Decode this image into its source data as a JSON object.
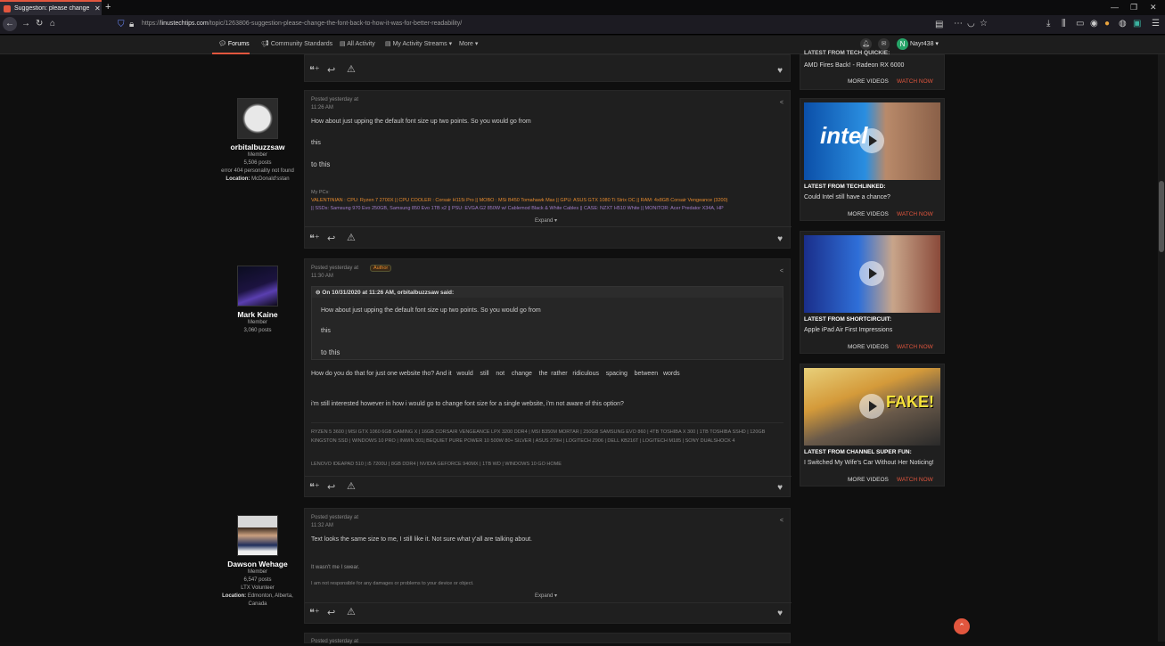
{
  "browser": {
    "tab_title": "Suggestion: please change the",
    "url_prefix": "https://",
    "url_domain": "linustechtips.com",
    "url_path": "/topic/1263806-suggestion-please-change-the-font-back-to-how-it-was-for-better-readability/"
  },
  "site_nav": {
    "forums": "Forums",
    "community_standards": "Community Standards",
    "all_activity": "All Activity",
    "my_activity_streams": "My Activity Streams",
    "more": "More",
    "username": "Nayr438",
    "avatar_letter": "N"
  },
  "posts": [
    {
      "author": "orbitalbuzzsaw",
      "role": "Member",
      "posts": "5,506 posts",
      "extra": "error 404 personality not found",
      "location_label": "Location:",
      "location": "McDonald'sstan",
      "meta_line1": "Posted yesterday at",
      "meta_line2": "11:26 AM",
      "lines": [
        "How about just upping the default font size up two points. So you would go from",
        "this",
        "to this"
      ],
      "sig_heading": "My PCs:",
      "sig_line1": "VALENTINIAN : CPU: Ryzen 7 2700X || CPU COOLER : Corsair H115i Pro || MOBO : MSi B450 Tomahawk Max || GPU: ASUS GTX 1080 Ti Strix OC || RAM: 4x8GB Corsair Vengeance (3200)",
      "sig_line2": "|| SSDs: Samsung 970 Evo 250GB, Samsung 850 Evo 1TB x2 || PSU: EVGA G2 850W w/ Cablemod Black & White Cables || CASE: NZXT H510 White || MONITOR: Acer Predator X34A, HP",
      "expand": "Expand"
    },
    {
      "author": "Mark Kaine",
      "role": "Member",
      "posts": "3,060 posts",
      "meta_line1": "Posted yesterday at",
      "meta_line2": "11:30 AM",
      "author_badge": "Author",
      "quote_header": "On 10/31/2020 at 11:26 AM, orbitalbuzzsaw said:",
      "quote_lines": [
        "How about just upping the default font size up two points. So you would go from",
        "this",
        "to this"
      ],
      "line1": "How do you do that for just one website tho? And it   would    still    not    change    the  rather   ridiculous    spacing    between   words",
      "line2": "i'm still interested however in how i would go to change font size for a single website, i'm not aware of this option?",
      "sig1": "RYZEN 5 3600 | MSI GTX 1060 6GB GAMING X | 16GB CORSAIR VENGEANCE LPX 3200 DDR4 | MSI B350M MORTAR | 250GB SAMSUNG EVO 860 | 4TB TOSHIBA X 300 | 1TB TOSHIBA SSHD | 120GB KINGSTON SSD | WINDOWS 10 PRO | INWIN 301| BEQUIET PURE POWER 10 500W 80+ SILVER | ASUS 279H | LOGITECH Z906 | DELL KB216T | LOGITECH M185 | SONY DUALSHOCK 4",
      "sig2": "LENOVO IDEAPAD 510 | i5 7200U | 8GB DDR4 | NVIDIA GEFORCE 940MX | 1TB WD | WINDOWS 10 GO HOME"
    },
    {
      "author": "Dawson Wehage",
      "role": "Member",
      "posts": "6,547 posts",
      "extra": "LTX Volunteer",
      "location_label": "Location:",
      "location": "Edmonton, Alberta, Canada",
      "meta_line1": "Posted yesterday at",
      "meta_line2": "11:32 AM",
      "line1": "Text looks the same size to me, I still like it. Not sure what y'all are talking about.",
      "sig1": "It wasn't me I swear.",
      "sig2": "I am not responsible for any damages or problems to your device or object.",
      "expand": "Expand"
    }
  ],
  "next_post_meta": "Posted yesterday at",
  "sidebar": [
    {
      "label": "LATEST FROM TECH QUICKIE:",
      "title": "AMD Fires Back! - Radeon RX 6000",
      "more": "MORE VIDEOS",
      "watch": "WATCH NOW"
    },
    {
      "label": "LATEST FROM TECHLINKED:",
      "title": "Could Intel still have a chance?",
      "more": "MORE VIDEOS",
      "watch": "WATCH NOW"
    },
    {
      "label": "LATEST FROM SHORTCIRCUIT:",
      "title": "Apple iPad Air First Impressions",
      "more": "MORE VIDEOS",
      "watch": "WATCH NOW"
    },
    {
      "label": "LATEST FROM CHANNEL SUPER FUN:",
      "title": "I Switched My Wife's Car Without Her Noticing!",
      "more": "MORE VIDEOS",
      "watch": "WATCH NOW",
      "thumb_text": "FAKE!"
    }
  ],
  "colors": {
    "accent": "#e2563e",
    "bg": "#0f0f0f",
    "card": "#1f1f1f"
  }
}
